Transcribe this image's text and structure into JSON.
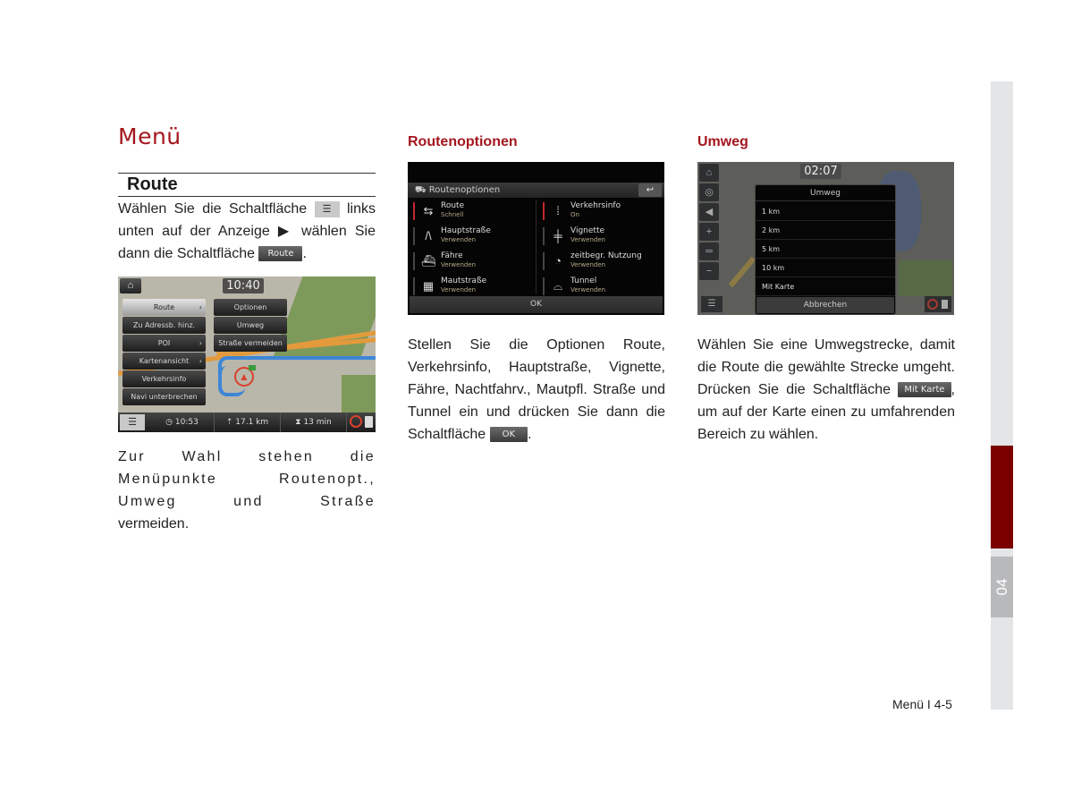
{
  "page": {
    "heading": "Menü",
    "section": "Route",
    "footer": "Menü I 4-5",
    "chapter_tab": "04",
    "accent_color": "#a3161d"
  },
  "col1": {
    "intro_part1": "Wählen Sie die Schaltfläche",
    "intro_part2": "links unten auf der Anzeige ▶ wählen Sie dann die Schaltfläche",
    "intro_end": ".",
    "inline_icon": "menu-icon",
    "inline_button": "Route",
    "outro": "Zur Wahl stehen die Menüpunkte Routenopt., Umweg und Straße",
    "outro_end": "vermeiden.",
    "screen": {
      "clock": "10:40",
      "home_icon": "home-icon",
      "left_menu": [
        {
          "label": "Route",
          "active": true,
          "chevron": "‹"
        },
        {
          "label": "Zu Adressb. hinz.",
          "active": false,
          "chevron": ""
        },
        {
          "label": "POI",
          "active": false,
          "chevron": "›"
        },
        {
          "label": "Kartenansicht",
          "active": false,
          "chevron": "›"
        },
        {
          "label": "Verkehrsinfo",
          "active": false,
          "chevron": ""
        },
        {
          "label": "Navi unterbrechen",
          "active": false,
          "chevron": ""
        }
      ],
      "right_menu": [
        {
          "label": "Optionen"
        },
        {
          "label": "Umweg"
        },
        {
          "label": "Straße vermeiden"
        }
      ],
      "status": {
        "arrival": "10:53",
        "distance": "17.1 km",
        "duration": "13 min"
      }
    }
  },
  "col2": {
    "title": "Routenoptionen",
    "text": "Stellen Sie die Optionen Route, Verkehrsinfo, Hauptstraße, Vignette, Fähre, Nachtfahrv., Mautpfl. Straße und Tunnel ein und drücken Sie dann die Schaltfläche",
    "text_end": ".",
    "inline_button": "OK",
    "screen": {
      "header": "Routenoptionen",
      "back_icon": "↩",
      "options": [
        {
          "label": "Route",
          "value": "Schnell",
          "icon": "⇆",
          "marked": true
        },
        {
          "label": "Verkehrsinfo",
          "value": "On",
          "icon": "⁞",
          "marked": true
        },
        {
          "label": "Hauptstraße",
          "value": "Verwenden",
          "icon": "/\\",
          "marked": false
        },
        {
          "label": "Vignette",
          "value": "Verwenden",
          "icon": "╪",
          "marked": false
        },
        {
          "label": "Fähre",
          "value": "Verwenden",
          "icon": "⛴",
          "marked": false
        },
        {
          "label": "zeitbegr. Nutzung",
          "value": "Verwenden",
          "icon": "◔",
          "marked": false
        },
        {
          "label": "Mautstraße",
          "value": "Verwenden",
          "icon": "▦",
          "marked": false
        },
        {
          "label": "Tunnel",
          "value": "Verwenden",
          "icon": "⌓",
          "marked": false
        }
      ],
      "ok": "OK"
    }
  },
  "col3": {
    "title": "Umweg",
    "text1": "Wählen Sie eine Umwegstrecke, damit die Route die gewählte Strecke umgeht. Drücken Sie die Schaltfläche",
    "inline_button": "Mit Karte",
    "text2": ", um auf der Karte einen zu umfahrenden Bereich zu wählen.",
    "screen": {
      "clock": "02:07",
      "dialog_title": "Umweg",
      "items": [
        "1 km",
        "2 km",
        "5 km",
        "10 km",
        "Mit Karte"
      ],
      "cancel": "Abbrechen",
      "side_buttons": [
        "⌂",
        "◎",
        "◀",
        "+",
        "═",
        "−"
      ]
    }
  }
}
